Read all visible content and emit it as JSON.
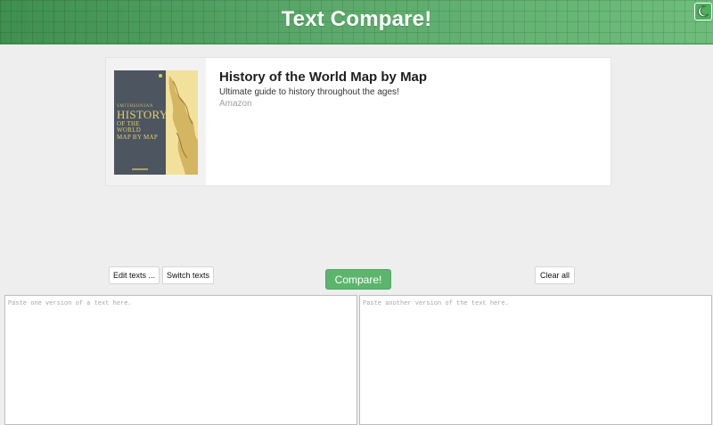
{
  "header": {
    "title": "Text Compare!",
    "theme_icon": "moon-icon",
    "accent_color": "#5aa96a"
  },
  "ad": {
    "title": "History of the World Map by Map",
    "description": "Ultimate guide to history throughout the ages!",
    "source": "Amazon",
    "book_cover": {
      "line1": "SMITHSONIAN",
      "line2": "HISTORY",
      "line3": "OF THE WORLD",
      "line4": "MAP BY MAP"
    }
  },
  "toolbar": {
    "edit_label": "Edit texts ...",
    "switch_label": "Switch texts",
    "compare_label": "Compare!",
    "clear_label": "Clear all"
  },
  "inputs": {
    "left_placeholder": "Paste one version of a text here.",
    "right_placeholder": "Paste another version of the text here.",
    "left_value": "",
    "right_value": ""
  }
}
